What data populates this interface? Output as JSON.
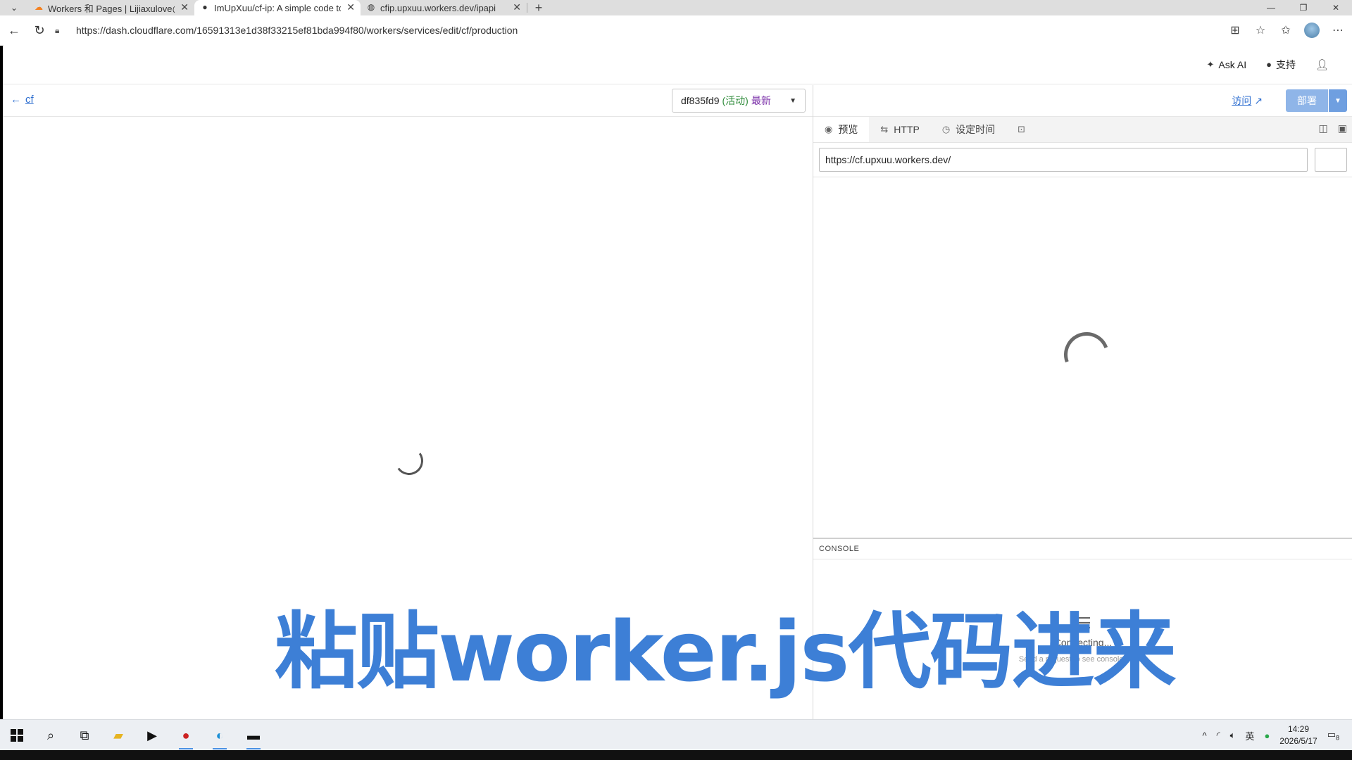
{
  "browser": {
    "tabs": [
      {
        "label": "Workers 和 Pages | Lijiaxulove@ou",
        "icon": "cloudflare-icon",
        "active": false
      },
      {
        "label": "ImUpXuu/cf-ip: A simple code to g",
        "icon": "github-icon",
        "active": true
      },
      {
        "label": "cfip.upxuu.workers.dev/ipapi",
        "icon": "globe-icon",
        "active": false
      }
    ],
    "url": "https://dash.cloudflare.com/16591313e1d38f33215ef81bda994f80/workers/services/edit/cf/production"
  },
  "topbar": {
    "ask_ai": "Ask AI",
    "support": "支持"
  },
  "editor": {
    "back_label": "cf",
    "version": {
      "id": "df835fd9",
      "status": "(活动)",
      "tag": "最新"
    }
  },
  "preview": {
    "visit": "访问",
    "deploy": "部署",
    "tabs": [
      {
        "label": "预览",
        "icon": "eye-icon"
      },
      {
        "label": "HTTP",
        "icon": "arrows-icon"
      },
      {
        "label": "设定时间",
        "icon": "clock-icon"
      }
    ],
    "url_value": "https://cf.upxuu.workers.dev/",
    "console_title": "CONSOLE",
    "connecting": "Connecting...",
    "console_hint": "Send a request to see console output"
  },
  "caption": "粘贴worker.js代码进来",
  "taskbar": {
    "ime": "英",
    "time": "14:29",
    "date": "2026/5/17",
    "notifications": "8"
  },
  "colors": {
    "link": "#2f6fd0",
    "deploy": "#8fb5e8",
    "caption": "#3d7fd6",
    "active_status": "#2e8b3a",
    "latest_tag": "#7a2ea8"
  }
}
